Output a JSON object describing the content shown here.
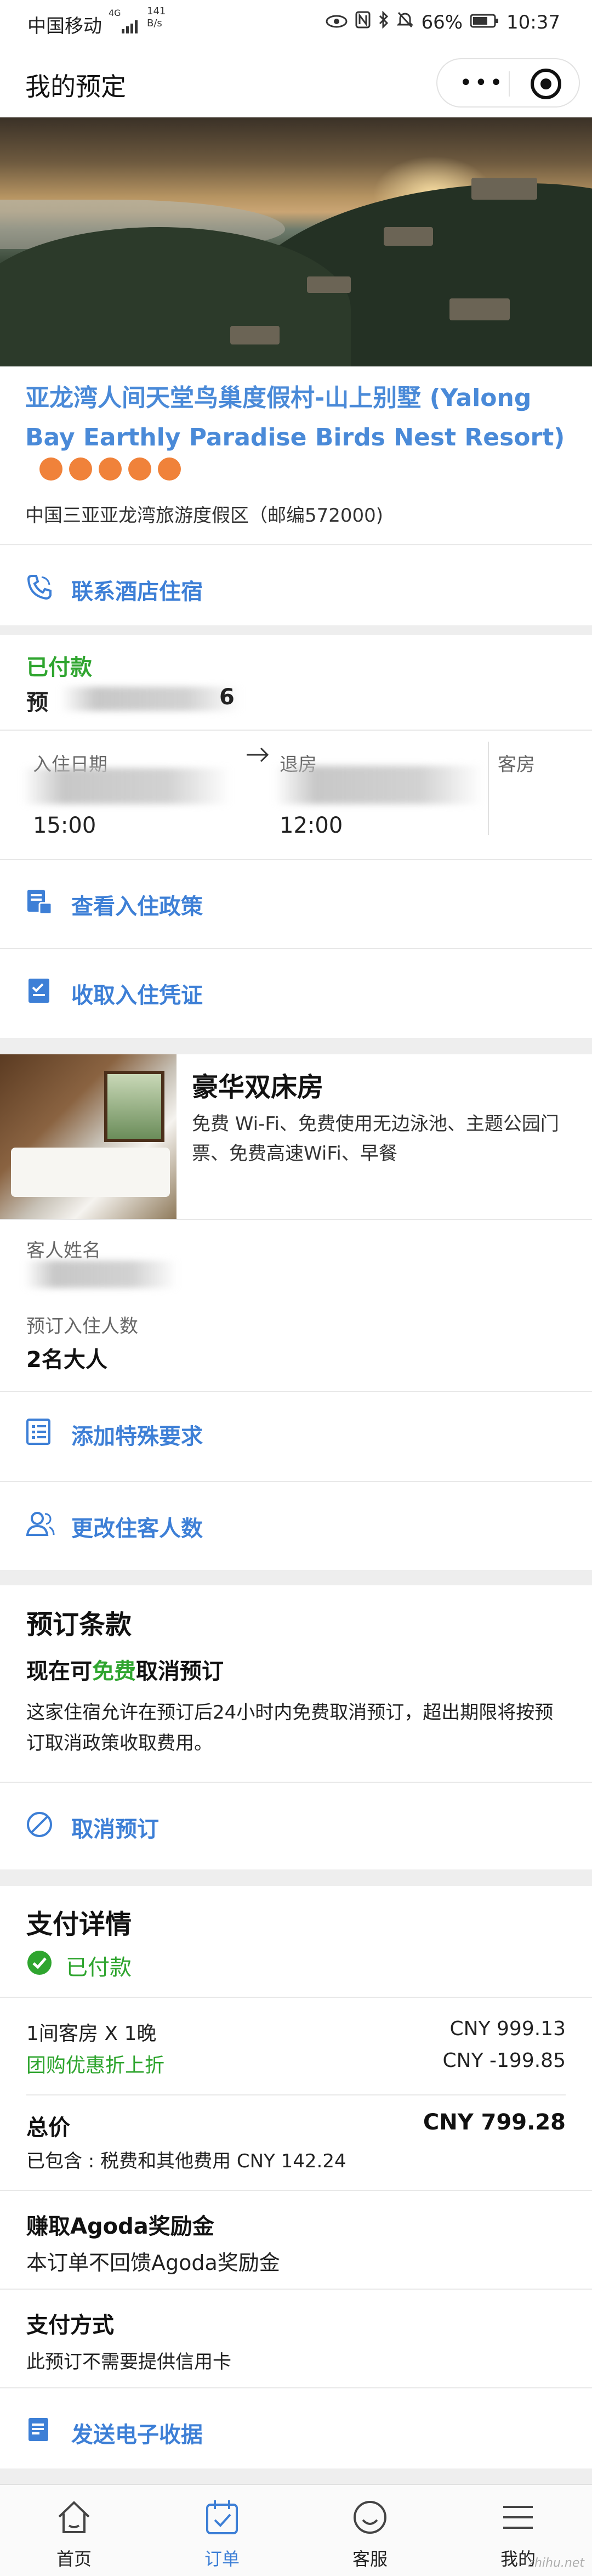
{
  "status_bar": {
    "carrier": "中国移动",
    "signal": "4G",
    "net_speed_value": "141",
    "net_speed_unit": "B/s",
    "battery": "66%",
    "time": "10:37"
  },
  "header": {
    "title": "我的预定"
  },
  "hotel": {
    "name": "亚龙湾人间天堂鸟巢度假村-山上别墅 (Yalong Bay Earthly Paradise Birds Nest Resort)",
    "star_count": 5,
    "address": "中国三亚亚龙湾旅游度假区（邮编572000)"
  },
  "actions": {
    "contact_hotel": "联系酒店住宿",
    "view_policy": "查看入住政策",
    "get_voucher": "收取入住凭证",
    "special_request": "添加特殊要求",
    "change_guests": "更改住客人数",
    "cancel_booking": "取消预订",
    "send_receipt": "发送电子收据"
  },
  "booking": {
    "status": "已付款",
    "number_prefix": "预",
    "number_suffix": "6",
    "checkin_label": "入住日期",
    "checkout_label": "退房",
    "rooms_label": "客房",
    "checkin_time": "15:00",
    "checkout_time": "12:00"
  },
  "room": {
    "title": "豪华双床房",
    "amenities": "免费 Wi-Fi、免费使用无边泳池、主题公园门票、免费高速WiFi、早餐",
    "guest_name_label": "客人姓名",
    "guest_count_label": "预订入住人数",
    "guest_count": "2名大人"
  },
  "terms": {
    "heading": "预订条款",
    "subtitle_before": "现在可",
    "subtitle_free": "免费",
    "subtitle_after": "取消预订",
    "body": "这家住宿允许在预订后24小时内免费取消预订，超出期限将按预订取消政策收取费用。"
  },
  "payment": {
    "heading": "支付详情",
    "status": "已付款",
    "room_line_label": "1间客房 X 1晚",
    "room_line_value": "CNY 999.13",
    "discount_label": "团购优惠折上折",
    "discount_value": "CNY -199.85",
    "total_label": "总价",
    "total_value": "CNY 799.28",
    "tax_note": "已包含 : 税费和其他费用 CNY 142.24",
    "reward_heading": "赚取Agoda奖励金",
    "reward_body": "本订单不回馈Agoda奖励金",
    "method_heading": "支付方式",
    "method_body": "此预订不需要提供信用卡"
  },
  "tabbar": {
    "items": [
      {
        "label": "首页",
        "icon": "home-icon"
      },
      {
        "label": "订单",
        "icon": "orders-icon"
      },
      {
        "label": "客服",
        "icon": "support-icon"
      },
      {
        "label": "我的",
        "icon": "menu-icon"
      }
    ]
  },
  "watermark": "zhihu.net",
  "colors": {
    "link_blue": "#3d7fd6",
    "hotel_name_blue": "#4a8ad8",
    "paid_green": "#2fa52f",
    "star_orange": "#f0823a"
  }
}
